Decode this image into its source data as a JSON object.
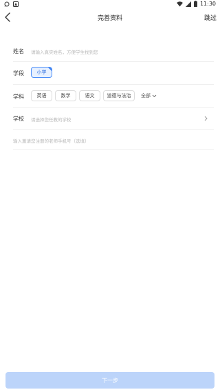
{
  "status_bar": {
    "time": "11:30"
  },
  "nav": {
    "title": "完善资料",
    "skip_label": "跳过"
  },
  "form": {
    "name": {
      "label": "姓名",
      "placeholder": "请输入真实姓名，方便学生找到您"
    },
    "stage": {
      "label": "学段",
      "options": [
        {
          "label": "小学",
          "selected": true
        }
      ]
    },
    "subject": {
      "label": "学科",
      "options": [
        {
          "label": "英语"
        },
        {
          "label": "数学"
        },
        {
          "label": "语文"
        },
        {
          "label": "道德与法治"
        }
      ],
      "all_label": "全部"
    },
    "school": {
      "label": "学校",
      "placeholder": "请选择您任教的学校"
    },
    "invite": {
      "placeholder": "输入邀请您注册的老师手机号（选填）"
    }
  },
  "footer": {
    "next_label": "下一步"
  },
  "colors": {
    "accent": "#4a8df8",
    "button_disabled": "#bcd4fa"
  }
}
